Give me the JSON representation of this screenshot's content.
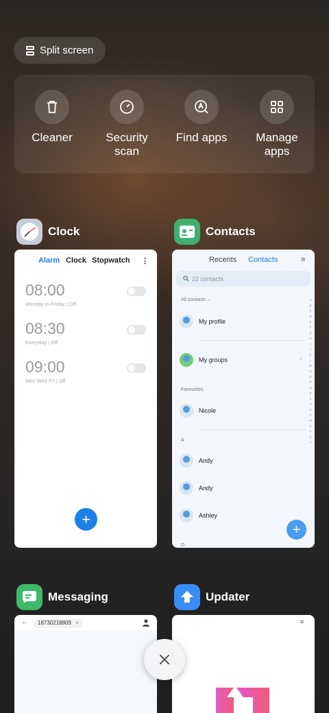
{
  "split_screen": {
    "label": "Split screen",
    "icon": "split-screen-icon"
  },
  "tools": [
    {
      "label": "Cleaner",
      "icon": "trash-icon"
    },
    {
      "label": "Security\nscan",
      "icon": "security-scan-icon"
    },
    {
      "label": "Find apps",
      "icon": "find-apps-icon"
    },
    {
      "label": "Manage\napps",
      "icon": "grid-icon"
    }
  ],
  "apps": {
    "clock": {
      "name": "Clock",
      "tabs": [
        "Alarm",
        "Clock",
        "Stopwatch"
      ],
      "active_tab": "Alarm",
      "alarms": [
        {
          "time": "08:00",
          "detail": "Monday to Friday | Off"
        },
        {
          "time": "08:30",
          "detail": "Everyday | Off"
        },
        {
          "time": "09:00",
          "detail": "Mon Wed Fri | Off"
        }
      ],
      "fab": "+"
    },
    "contacts": {
      "name": "Contacts",
      "tabs": [
        "Recents",
        "Contacts"
      ],
      "active_tab": "Contacts",
      "search_placeholder": "22 contacts",
      "filter": "All contacts",
      "my_profile": "My profile",
      "my_groups": "My groups",
      "favourites_header": "Favourites",
      "favourites": [
        "Nicole"
      ],
      "section_a": "A",
      "contacts_a": [
        "Andy",
        "Andy",
        "Ashley"
      ],
      "section_d": "D",
      "alphabet": [
        "A",
        "B",
        "C",
        "D",
        "E",
        "F",
        "G",
        "H",
        "I",
        "J",
        "K",
        "L",
        "M",
        "N",
        "O",
        "P",
        "Q",
        "R",
        "S",
        "T",
        "U",
        "V",
        "W",
        "X",
        "Y",
        "Z",
        "#"
      ],
      "fab": "+"
    },
    "messaging": {
      "name": "Messaging",
      "recipient": "18730218809"
    },
    "updater": {
      "name": "Updater"
    }
  },
  "colors": {
    "accent": "#1d7fe6",
    "contacts_icon": "#3fb06d",
    "messaging_icon": "#3fb86a",
    "updater_icon": "#3a8df5"
  }
}
